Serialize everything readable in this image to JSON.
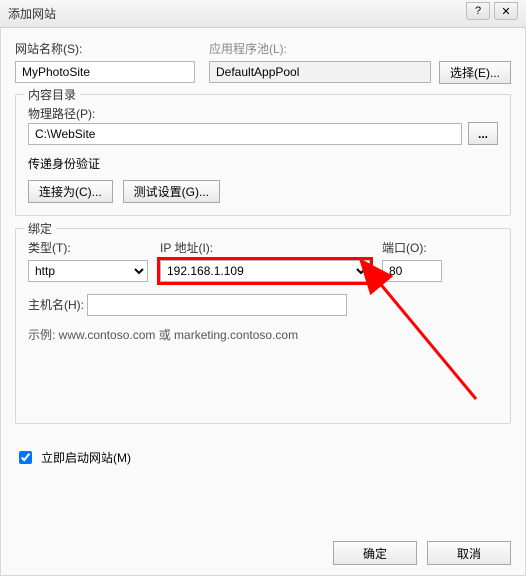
{
  "title": "添加网站",
  "siteName": {
    "label": "网站名称(S):",
    "value": "MyPhotoSite"
  },
  "appPool": {
    "label": "应用程序池(L):",
    "value": "DefaultAppPool",
    "selectBtn": "选择(E)..."
  },
  "content": {
    "legend": "内容目录",
    "pathLabel": "物理路径(P):",
    "pathValue": "C:\\WebSite",
    "browseDots": "...",
    "passthrough": "传递身份验证",
    "connectAs": "连接为(C)...",
    "testSettings": "测试设置(G)..."
  },
  "binding": {
    "legend": "绑定",
    "typeLabel": "类型(T):",
    "typeValue": "http",
    "ipLabel": "IP 地址(I):",
    "ipValue": "192.168.1.109",
    "portLabel": "端口(O):",
    "portValue": "80",
    "hostLabel": "主机名(H):",
    "hostValue": "",
    "example": "示例: www.contoso.com 或 marketing.contoso.com"
  },
  "startNow": "立即启动网站(M)",
  "ok": "确定",
  "cancel": "取消",
  "helpIcon": "?",
  "closeIcon": "✕"
}
